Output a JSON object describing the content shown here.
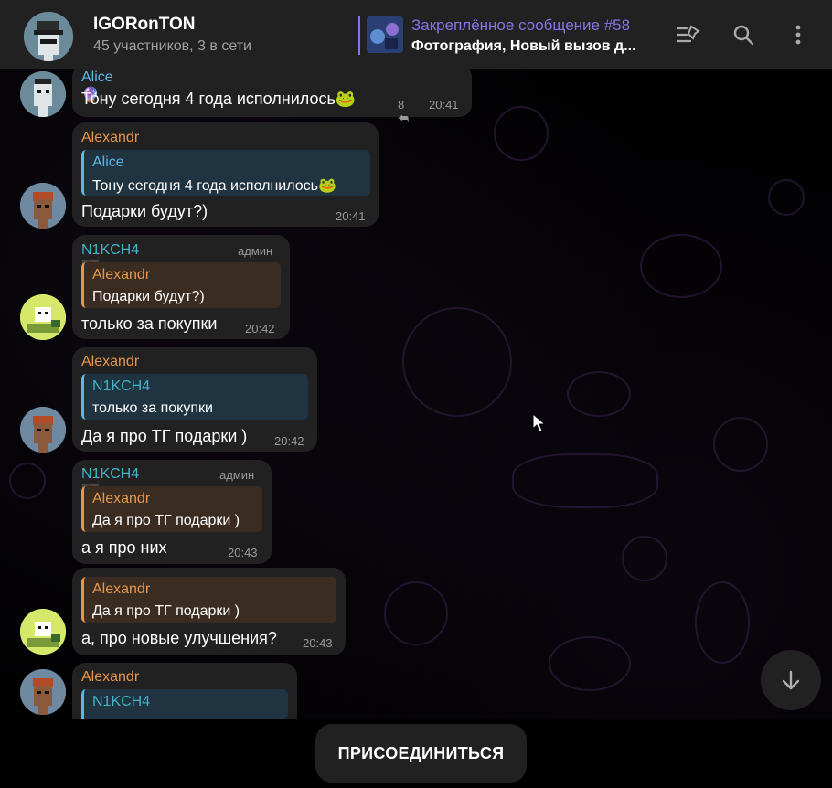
{
  "header": {
    "title": "IGORonTON",
    "subtitle": "45 участников, 3 в сети",
    "pinned_title": "Закреплённое сообщение #58",
    "pinned_text": "Фотография, Новый вызов д...",
    "accent": "#8774e1"
  },
  "messages": [
    {
      "sender": "Alice",
      "text": "Тону сегодня 4 года исполнилось",
      "reactions": "8",
      "time": "20:41"
    },
    {
      "sender": "Alexandr",
      "reply_name": "Alice",
      "reply_text": "Тону сегодня 4 года исполнилось",
      "text": "Подарки будут?)",
      "time": "20:41"
    },
    {
      "sender": "N1KCH4",
      "badge": "админ",
      "reply_name": "Alexandr",
      "reply_text": "Подарки будут?)",
      "text": "только за покупки",
      "time": "20:42"
    },
    {
      "sender": "Alexandr",
      "reply_name": "N1KCH4",
      "reply_text": "только за покупки",
      "text": "Да я про ТГ подарки )",
      "time": "20:42"
    },
    {
      "sender": "N1KCH4",
      "badge": "админ",
      "reply_name": "Alexandr",
      "reply_text": "Да я про ТГ подарки )",
      "text": "а я про них",
      "time": "20:43"
    },
    {
      "reply_name": "Alexandr",
      "reply_text": "Да я про ТГ подарки )",
      "text": "а, про новые улучшения?",
      "time": "20:43"
    },
    {
      "sender": "Alexandr",
      "reply_name": "N1KCH4"
    }
  ],
  "join_label": "ПРИСОЕДИНИТЬСЯ",
  "icons": {
    "pinned_list": "pinned-list-icon",
    "search": "search-icon",
    "more": "more-icon",
    "scroll_down": "arrow-down-icon"
  }
}
